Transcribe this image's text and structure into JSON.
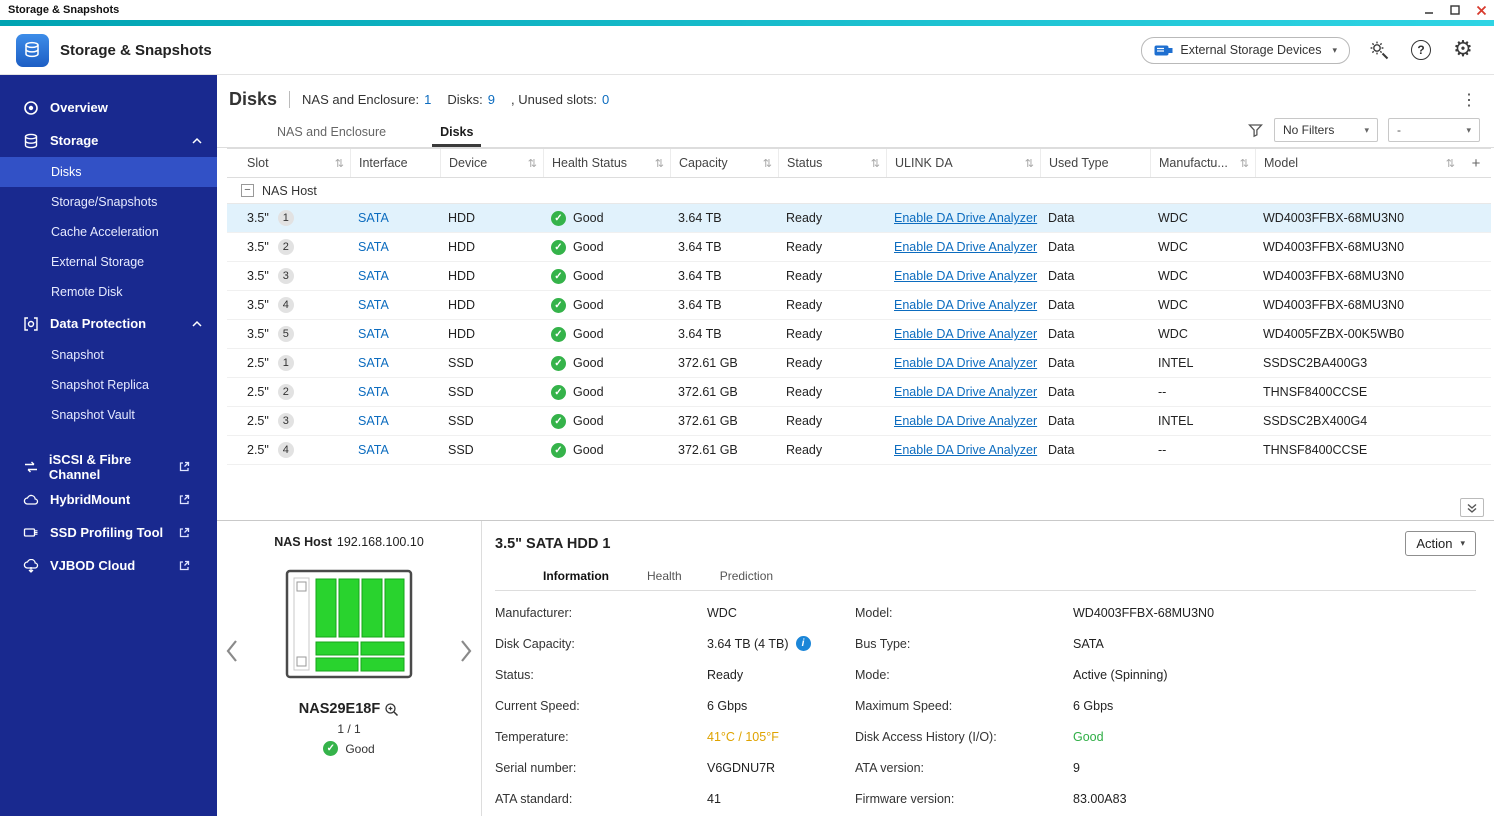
{
  "window": {
    "title": "Storage & Snapshots"
  },
  "appbar": {
    "title": "Storage & Snapshots",
    "external_storage_button": "External Storage Devices"
  },
  "sidebar": {
    "overview": "Overview",
    "storage": "Storage",
    "storage_items": [
      "Disks",
      "Storage/Snapshots",
      "Cache Acceleration",
      "External Storage",
      "Remote Disk"
    ],
    "data_protection": "Data Protection",
    "data_protection_items": [
      "Snapshot",
      "Snapshot Replica",
      "Snapshot Vault"
    ],
    "external_tools": [
      "iSCSI & Fibre Channel",
      "HybridMount",
      "SSD Profiling Tool",
      "VJBOD Cloud"
    ]
  },
  "page": {
    "title": "Disks",
    "summary": [
      {
        "label": "NAS and Enclosure:",
        "value": "1"
      },
      {
        "label": "Disks:",
        "value": "9"
      },
      {
        "label": ", Unused slots:",
        "value": "0"
      }
    ],
    "tabs": [
      {
        "label": "NAS and Enclosure",
        "active": false
      },
      {
        "label": "Disks",
        "active": true
      }
    ],
    "filter_select": "No Filters",
    "secondary_select": "-"
  },
  "table": {
    "columns": [
      {
        "label": "Slot",
        "sort": true
      },
      {
        "label": "Interface",
        "sort": false
      },
      {
        "label": "Device",
        "sort": true
      },
      {
        "label": "Health Status",
        "sort": true
      },
      {
        "label": "Capacity",
        "sort": true
      },
      {
        "label": "Status",
        "sort": true
      },
      {
        "label": "ULINK DA",
        "sort": true
      },
      {
        "label": "Used Type",
        "sort": false
      },
      {
        "label": "Manufactu...",
        "sort": true
      },
      {
        "label": "Model",
        "sort": true
      }
    ],
    "group_label": "NAS Host",
    "rows": [
      {
        "size": "3.5\"",
        "bay": "1",
        "interface": "SATA",
        "device": "HDD",
        "health": "Good",
        "capacity": "3.64 TB",
        "status": "Ready",
        "ulink": "Enable DA Drive Analyzer",
        "used_type": "Data",
        "manufacturer": "WDC",
        "model": "WD4003FFBX-68MU3N0",
        "selected": true
      },
      {
        "size": "3.5\"",
        "bay": "2",
        "interface": "SATA",
        "device": "HDD",
        "health": "Good",
        "capacity": "3.64 TB",
        "status": "Ready",
        "ulink": "Enable DA Drive Analyzer",
        "used_type": "Data",
        "manufacturer": "WDC",
        "model": "WD4003FFBX-68MU3N0",
        "selected": false
      },
      {
        "size": "3.5\"",
        "bay": "3",
        "interface": "SATA",
        "device": "HDD",
        "health": "Good",
        "capacity": "3.64 TB",
        "status": "Ready",
        "ulink": "Enable DA Drive Analyzer",
        "used_type": "Data",
        "manufacturer": "WDC",
        "model": "WD4003FFBX-68MU3N0",
        "selected": false
      },
      {
        "size": "3.5\"",
        "bay": "4",
        "interface": "SATA",
        "device": "HDD",
        "health": "Good",
        "capacity": "3.64 TB",
        "status": "Ready",
        "ulink": "Enable DA Drive Analyzer",
        "used_type": "Data",
        "manufacturer": "WDC",
        "model": "WD4003FFBX-68MU3N0",
        "selected": false
      },
      {
        "size": "3.5\"",
        "bay": "5",
        "interface": "SATA",
        "device": "HDD",
        "health": "Good",
        "capacity": "3.64 TB",
        "status": "Ready",
        "ulink": "Enable DA Drive Analyzer",
        "used_type": "Data",
        "manufacturer": "WDC",
        "model": "WD4005FZBX-00K5WB0",
        "selected": false
      },
      {
        "size": "2.5\"",
        "bay": "1",
        "interface": "SATA",
        "device": "SSD",
        "health": "Good",
        "capacity": "372.61 GB",
        "status": "Ready",
        "ulink": "Enable DA Drive Analyzer",
        "used_type": "Data",
        "manufacturer": "INTEL",
        "model": "SSDSC2BA400G3",
        "selected": false
      },
      {
        "size": "2.5\"",
        "bay": "2",
        "interface": "SATA",
        "device": "SSD",
        "health": "Good",
        "capacity": "372.61 GB",
        "status": "Ready",
        "ulink": "Enable DA Drive Analyzer",
        "used_type": "Data",
        "manufacturer": "--",
        "model": "THNSF8400CCSE",
        "selected": false
      },
      {
        "size": "2.5\"",
        "bay": "3",
        "interface": "SATA",
        "device": "SSD",
        "health": "Good",
        "capacity": "372.61 GB",
        "status": "Ready",
        "ulink": "Enable DA Drive Analyzer",
        "used_type": "Data",
        "manufacturer": "INTEL",
        "model": "SSDSC2BX400G4",
        "selected": false
      },
      {
        "size": "2.5\"",
        "bay": "4",
        "interface": "SATA",
        "device": "SSD",
        "health": "Good",
        "capacity": "372.61 GB",
        "status": "Ready",
        "ulink": "Enable DA Drive Analyzer",
        "used_type": "Data",
        "manufacturer": "--",
        "model": "THNSF8400CCSE",
        "selected": false
      }
    ]
  },
  "nas_panel": {
    "host_label": "NAS Host",
    "host_ip": "192.168.100.10",
    "name": "NAS29E18F",
    "pager": "1 / 1",
    "health": "Good"
  },
  "detail": {
    "title": "3.5\" SATA HDD 1",
    "action_button": "Action",
    "tabs": [
      {
        "label": "Information",
        "active": true
      },
      {
        "label": "Health",
        "active": false
      },
      {
        "label": "Prediction",
        "active": false
      }
    ],
    "rows": [
      {
        "l1": "Manufacturer:",
        "v1": "WDC",
        "l2": "Model:",
        "v2": "WD4003FFBX-68MU3N0"
      },
      {
        "l1": "Disk Capacity:",
        "v1": "3.64 TB (4 TB)",
        "v1_info": true,
        "l2": "Bus Type:",
        "v2": "SATA"
      },
      {
        "l1": "Status:",
        "v1": "Ready",
        "l2": "Mode:",
        "v2": "Active (Spinning)"
      },
      {
        "l1": "Current Speed:",
        "v1": "6 Gbps",
        "l2": "Maximum Speed:",
        "v2": "6 Gbps"
      },
      {
        "l1": "Temperature:",
        "v1": "41°C / 105°F",
        "v1_color": "#dfa300",
        "l2": "Disk Access History (I/O):",
        "v2": "Good",
        "v2_color": "#2fae46"
      },
      {
        "l1": "Serial number:",
        "v1": "V6GDNU7R",
        "l2": "ATA version:",
        "v2": "9"
      },
      {
        "l1": "ATA standard:",
        "v1": "41",
        "l2": "Firmware version:",
        "v2": "83.00A83"
      }
    ]
  },
  "icons": {
    "kebab": "⋮",
    "caret": "▾",
    "sort_arrows": "⇅",
    "add_column": "+",
    "collapse_group": "−",
    "check": "✓",
    "info": "i",
    "help": "?",
    "gear": "⚙"
  },
  "colors": {
    "accent_blue": "#0c6cbf",
    "sidebar_blue": "#19298f",
    "selected_item_blue": "#3251c6",
    "selected_row": "#e1f2fc",
    "good_green": "#35b34a",
    "temperature_amber": "#dfa300",
    "teal_stripe": "#00a3b2",
    "drive_green": "#29d32e"
  }
}
